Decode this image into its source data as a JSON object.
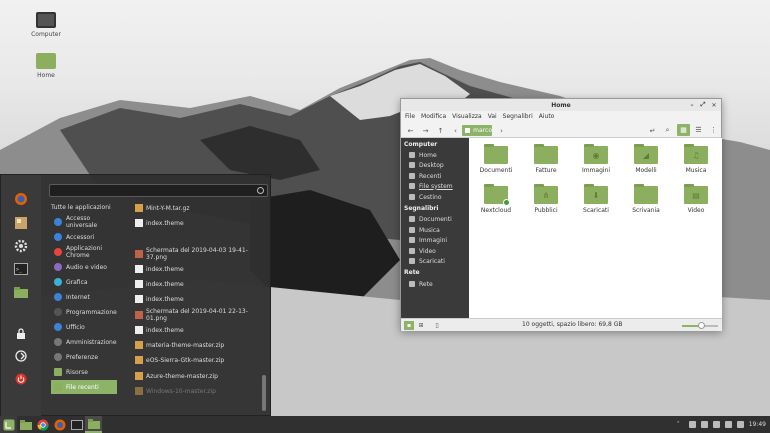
{
  "desktop": {
    "icons": [
      {
        "label": "Computer",
        "icon": "monitor-icon"
      },
      {
        "label": "Home",
        "icon": "home-folder-icon"
      }
    ]
  },
  "menu": {
    "search_placeholder": "",
    "favorites": [
      "firefox-icon",
      "software-manager-icon",
      "settings-icon",
      "terminal-icon",
      "files-icon"
    ],
    "session": [
      "lock-icon",
      "logout-icon",
      "power-icon"
    ],
    "categories": [
      {
        "label": "Tutte le applicazioni",
        "color": ""
      },
      {
        "label": "Accesso universale",
        "color": "#3d82d9"
      },
      {
        "label": "Accessori",
        "color": "#3d82d9"
      },
      {
        "label": "Applicazioni Chrome",
        "color": "#e5453a"
      },
      {
        "label": "Audio e video",
        "color": "#8c6bbf"
      },
      {
        "label": "Grafica",
        "color": "#3db0d9"
      },
      {
        "label": "Internet",
        "color": "#3d82d9"
      },
      {
        "label": "Programmazione",
        "color": "#555555"
      },
      {
        "label": "Ufficio",
        "color": "#3d82d9"
      },
      {
        "label": "Amministrazione",
        "color": "#777777"
      },
      {
        "label": "Preferenze",
        "color": "#777777"
      },
      {
        "label": "Risorse",
        "color": "#8cae5f"
      },
      {
        "label": "File recenti",
        "color": "#8cae5f"
      }
    ],
    "selected_category": "File recenti",
    "files": [
      {
        "label": "Mint-Y-M.tar.gz",
        "type": "archive"
      },
      {
        "label": "index.theme",
        "type": "text"
      },
      {
        "label": "Schermata del 2019-04-03 19-41-37.png",
        "type": "image"
      },
      {
        "label": "index.theme",
        "type": "text"
      },
      {
        "label": "index.theme",
        "type": "text"
      },
      {
        "label": "index.theme",
        "type": "text"
      },
      {
        "label": "Schermata del 2019-04-01 22-13-01.png",
        "type": "image"
      },
      {
        "label": "index.theme",
        "type": "text"
      },
      {
        "label": "materia-theme-master.zip",
        "type": "archive"
      },
      {
        "label": "eOS-Sierra-Gtk-master.zip",
        "type": "archive"
      },
      {
        "label": "Azure-theme-master.zip",
        "type": "archive"
      },
      {
        "label": "Windows-10-master.zip",
        "type": "archive"
      }
    ]
  },
  "file_manager": {
    "title": "Home",
    "window_controls": {
      "minimize": "–",
      "maximize": "⤢",
      "close": "✕"
    },
    "menubar": [
      "File",
      "Modifica",
      "Visualizza",
      "Vai",
      "Segnalibri",
      "Aiuto"
    ],
    "breadcrumb": "marco",
    "sidebar": {
      "sections": [
        {
          "title": "Computer",
          "items": [
            "Home",
            "Desktop",
            "Recenti",
            "File system",
            "Cestino"
          ]
        },
        {
          "title": "Segnalibri",
          "items": [
            "Documenti",
            "Musica",
            "Immagini",
            "Video",
            "Scaricati"
          ]
        },
        {
          "title": "Rete",
          "items": [
            "Rete"
          ]
        }
      ]
    },
    "items": [
      {
        "label": "Documenti",
        "emblem": ""
      },
      {
        "label": "Fatture",
        "emblem": ""
      },
      {
        "label": "Immagini",
        "emblem": "◉"
      },
      {
        "label": "Modelli",
        "emblem": "◢"
      },
      {
        "label": "Musica",
        "emblem": "♫"
      },
      {
        "label": "Nextcloud",
        "emblem": ""
      },
      {
        "label": "Pubblici",
        "emblem": "⋔"
      },
      {
        "label": "Scaricati",
        "emblem": "⬇"
      },
      {
        "label": "Scrivania",
        "emblem": ""
      },
      {
        "label": "Video",
        "emblem": "▤"
      }
    ],
    "status_text": "10 oggetti, spazio libero: 69,8 GB",
    "zoom_level": 0.55
  },
  "panel": {
    "launchers": [
      "mint-menu-icon",
      "files-icon",
      "chrome-icon",
      "firefox-icon",
      "terminal-icon",
      "files-window-icon"
    ],
    "clock": "19:49"
  }
}
